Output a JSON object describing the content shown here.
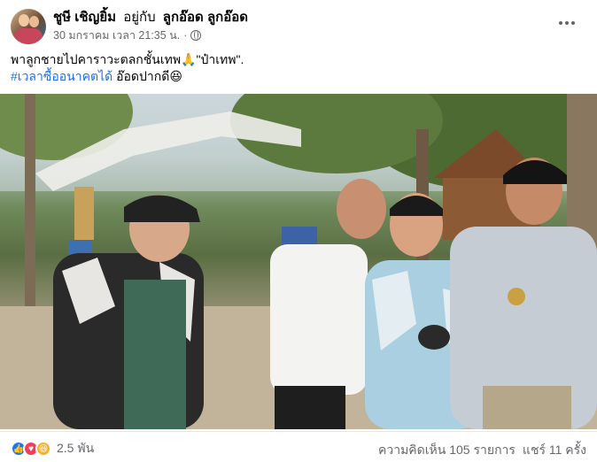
{
  "post": {
    "author": "ชูษี เชิญยิ้ม",
    "with_text": "อยู่กับ",
    "tagged": "ลูกอ๊อด ลูกอ๊อด",
    "timestamp": "30 มกราคม เวลา 21:35 น.",
    "separator": "·",
    "text_line1": "พาลูกชายไปคาราวะตลกชั้นเทพ🙏\"ป๋าเทพ\".",
    "hashtag": "#เวลาซื้ออนาคตได้",
    "text_line2_rest": " อ๊อดปากดี😆",
    "privacy_icon": "globe-icon",
    "more_icon": "more-horizontal-icon"
  },
  "reactions": {
    "icons": [
      "like-icon",
      "love-icon",
      "haha-icon"
    ],
    "count": "2.5 พัน"
  },
  "stats": {
    "comments": "ความคิดเห็น 105 รายการ",
    "shares": "แชร์ 11 ครั้ง"
  },
  "colors": {
    "link": "#216fdb",
    "like": "#1877f2",
    "love": "#f33e58",
    "haha": "#f7b125",
    "muted": "#65676b"
  }
}
